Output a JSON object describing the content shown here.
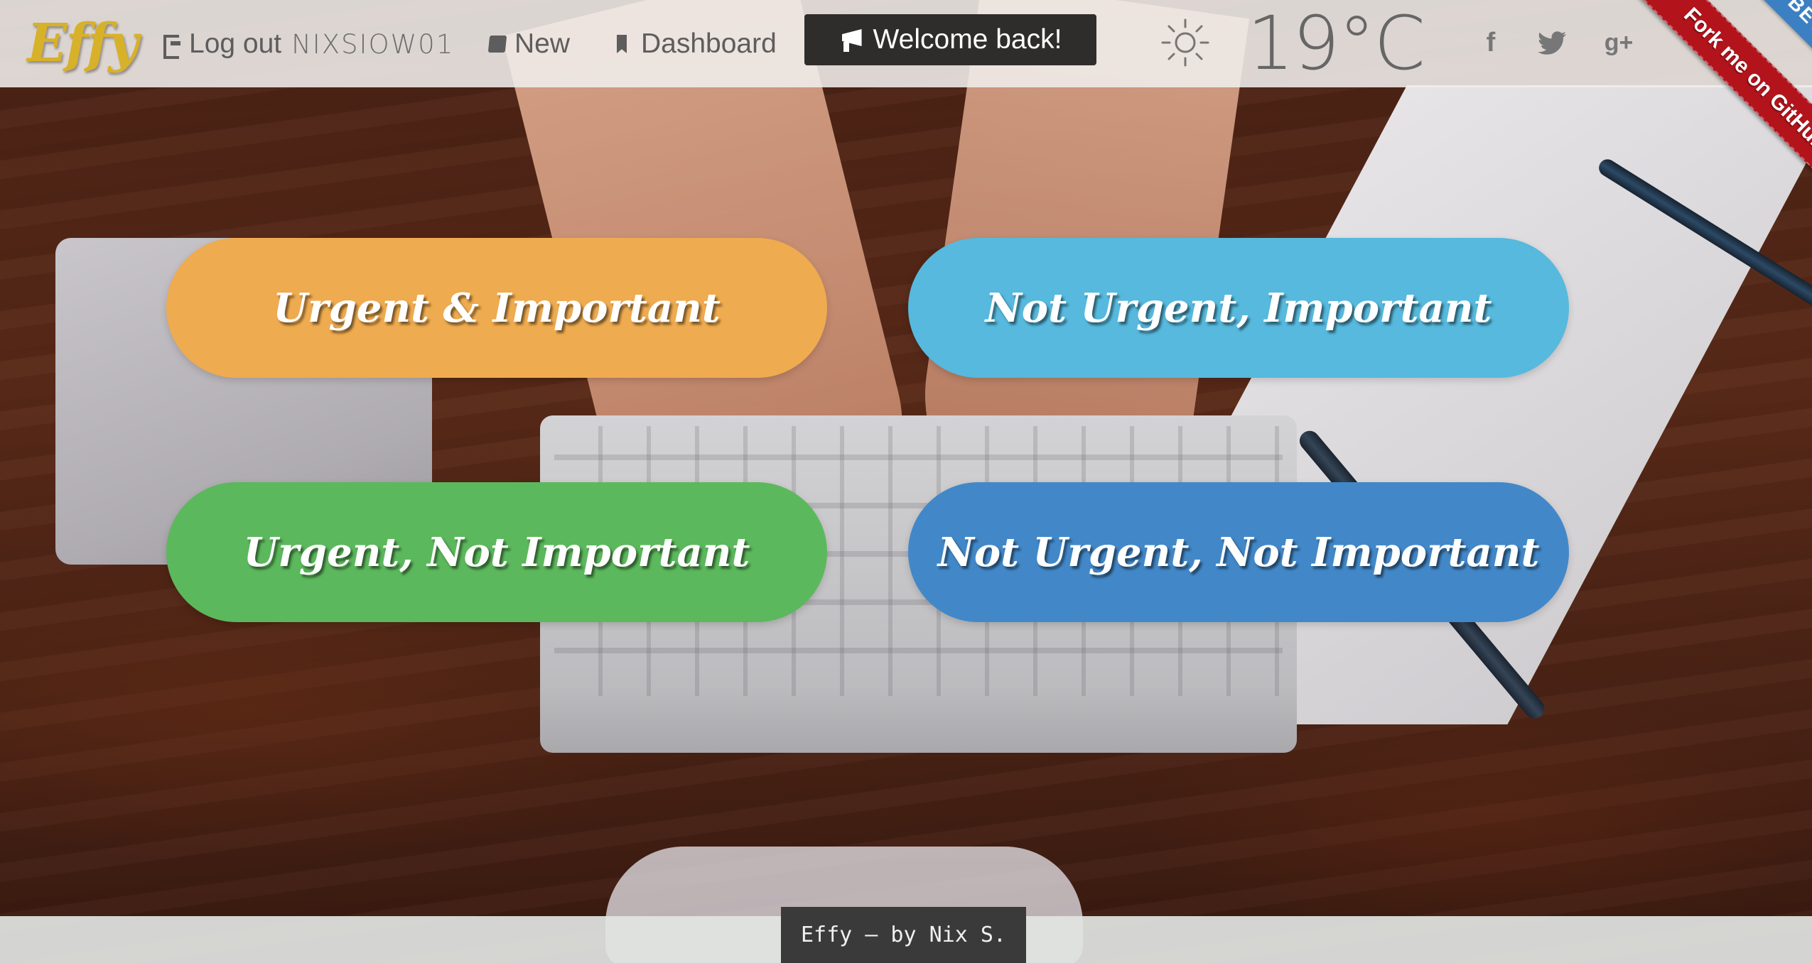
{
  "header": {
    "logo": "Effy",
    "logout_label": "Log out",
    "username": "NIXSIOW01",
    "new_label": "New",
    "dashboard_label": "Dashboard",
    "welcome_label": "Welcome back!",
    "weather": {
      "icon": "sun-icon",
      "temperature": "19°C"
    },
    "social": {
      "facebook": "f",
      "google_plus": "g+"
    }
  },
  "ribbon": {
    "github_label": "Fork me on GitHub",
    "beta_label": "BETA"
  },
  "quadrants": {
    "urgent_important": "Urgent & Important",
    "not_urgent_important": "Not Urgent, Important",
    "urgent_not_important": "Urgent, Not Important",
    "not_urgent_not_important": "Not Urgent, Not Important"
  },
  "colors": {
    "urgent_important": "#efab4f",
    "not_urgent_important": "#56b9dd",
    "urgent_not_important": "#5cb85c",
    "not_urgent_not_important": "#4288c8",
    "logo": "#d8b12a",
    "ribbon_red": "#b3141c",
    "ribbon_blue": "#3c80c4"
  },
  "footer": {
    "credit": "Effy – by Nix S."
  }
}
